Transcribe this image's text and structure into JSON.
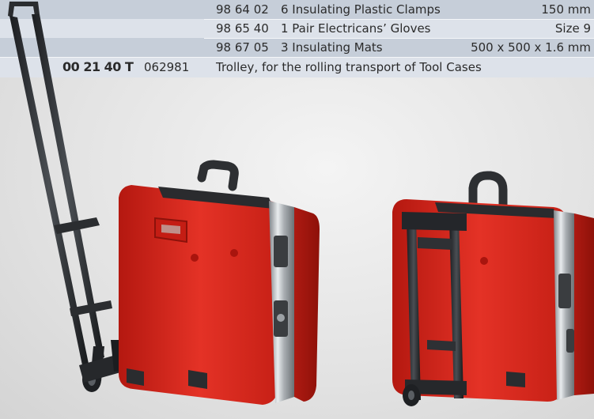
{
  "rows": [
    {
      "code": "98 64 02",
      "description": "6 Insulating Plastic Clamps",
      "size": "150 mm"
    },
    {
      "code": "98 65 40",
      "description": "1 Pair Electricans’ Gloves",
      "size": "Size 9"
    },
    {
      "code": "98 67 05",
      "description": "3 Insulating Mats",
      "size": "500 x 500 x 1.6 mm"
    }
  ],
  "trolley": {
    "item_number": "00 21 40 T",
    "article": "062981",
    "description": "Trolley, for the rolling transport of Tool Cases"
  },
  "colors": {
    "case_red": "#d8261c",
    "band_dark": "#c6ced9",
    "band_light": "#dde2ea"
  }
}
